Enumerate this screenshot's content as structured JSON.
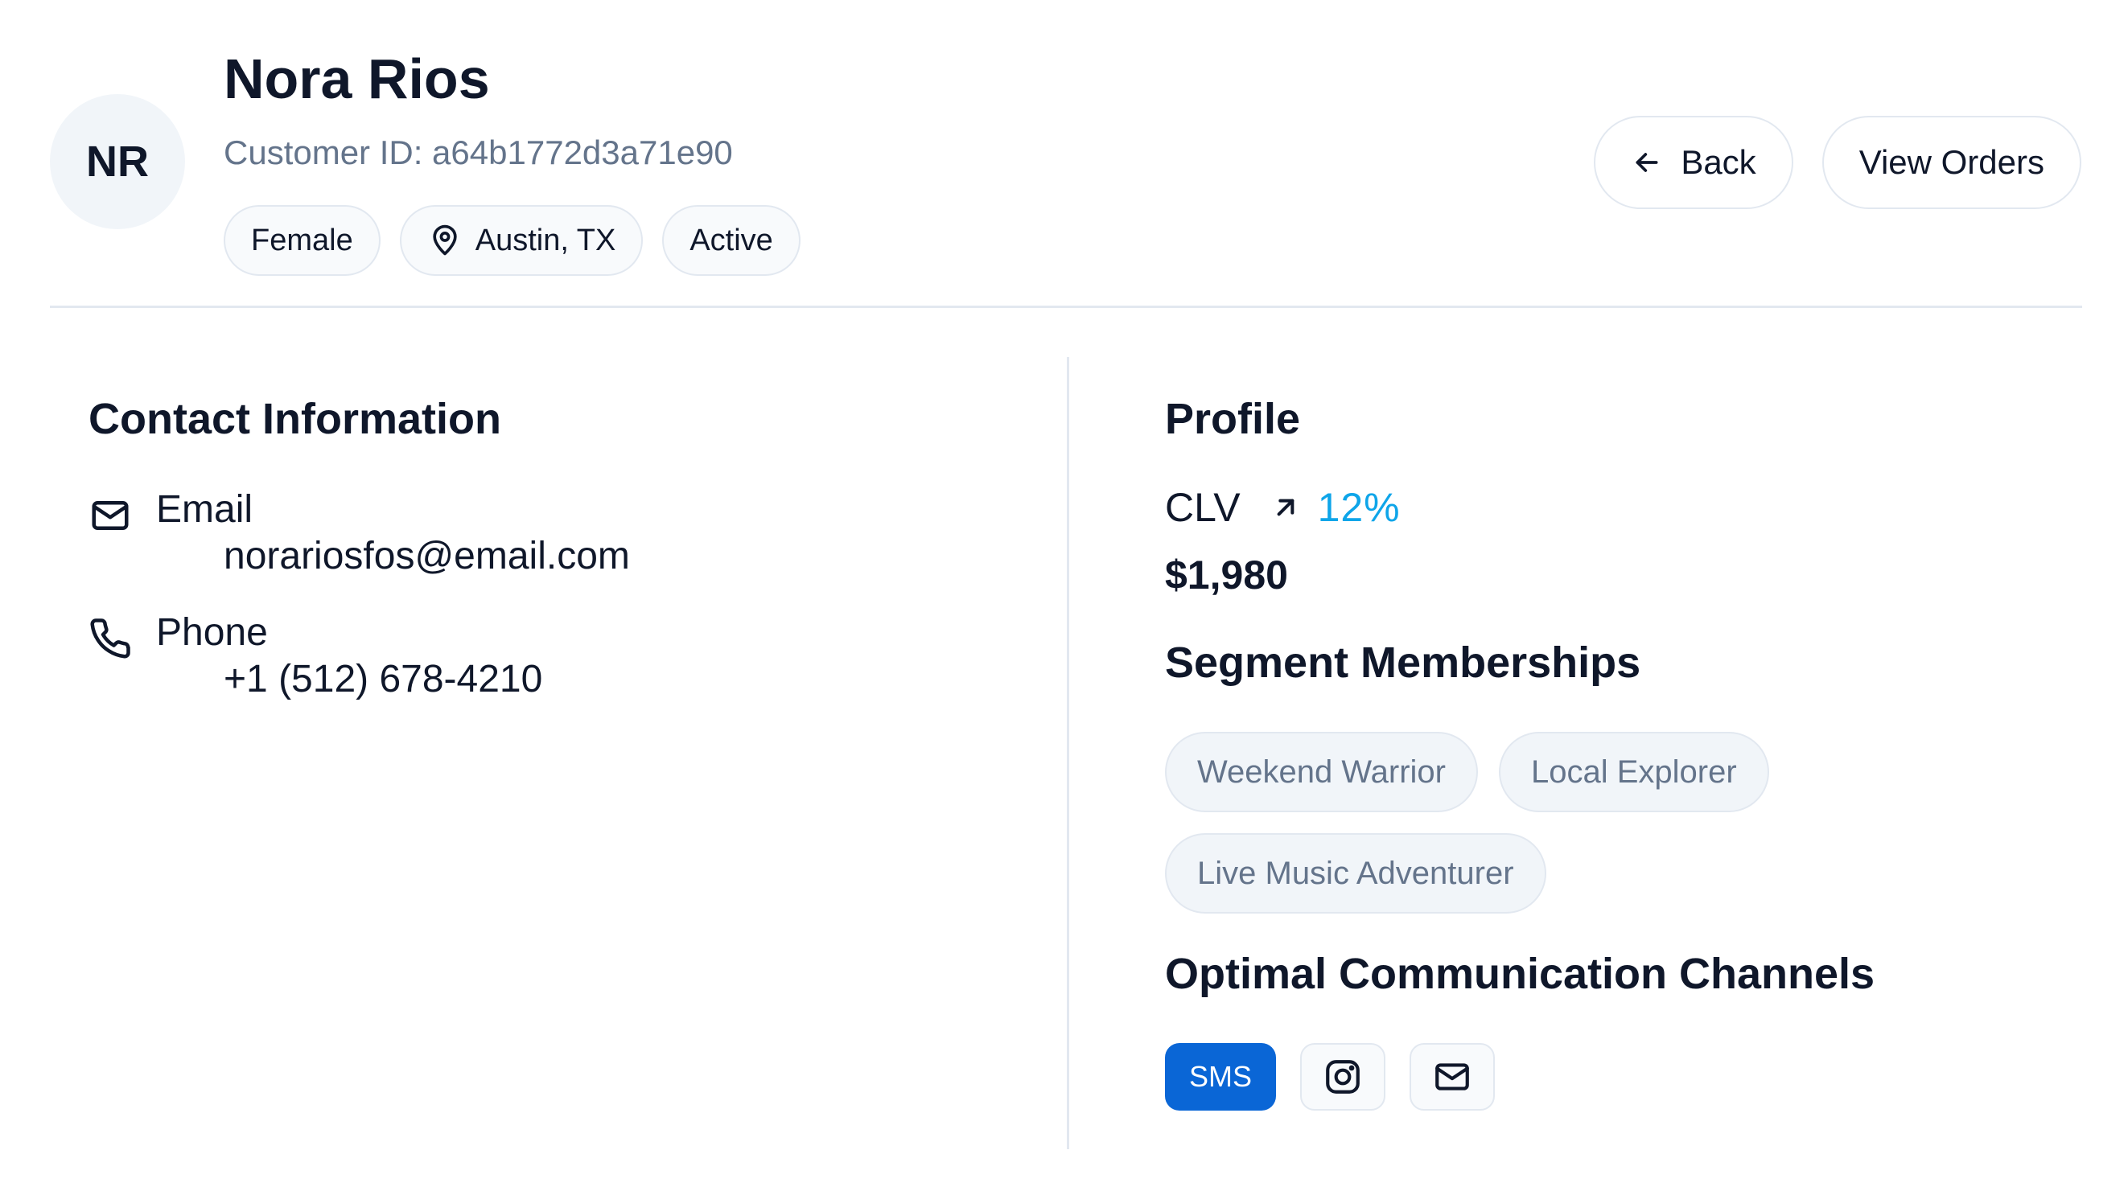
{
  "header": {
    "avatar_initials": "NR",
    "name": "Nora Rios",
    "customer_id": "Customer ID: a64b1772d3a71e90",
    "chips": [
      {
        "label": "Female",
        "icon": null
      },
      {
        "label": "Austin, TX",
        "icon": "map-pin-icon"
      },
      {
        "label": "Active",
        "icon": null
      }
    ],
    "back_label": "Back",
    "view_orders_label": "View Orders"
  },
  "contact": {
    "title": "Contact Information",
    "email_label": "Email",
    "email_value": "norariosfos@email.com",
    "phone_label": "Phone",
    "phone_value": "+1 (512) 678-4210"
  },
  "profile": {
    "title": "Profile",
    "clv_label": "CLV",
    "clv_change": "12%",
    "clv_value": "$1,980",
    "segments_title": "Segment Memberships",
    "segments": [
      "Weekend Warrior",
      "Local Explorer",
      "Live Music Adventurer"
    ],
    "channels_title": "Optimal Communication Channels",
    "channels": [
      {
        "label": "SMS",
        "active": true
      },
      {
        "icon": "instagram-icon",
        "active": false
      },
      {
        "icon": "mail-icon",
        "active": false
      }
    ]
  },
  "colors": {
    "accent_blue": "#0a66d6",
    "trend_cyan": "#0ea5e9",
    "muted_text": "#64748b",
    "border": "#e2e8f0"
  }
}
